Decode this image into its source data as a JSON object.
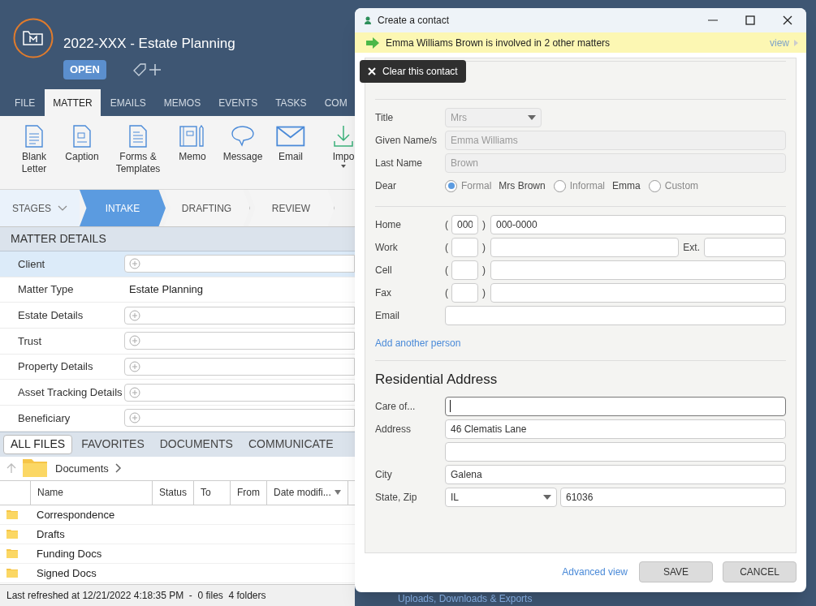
{
  "matter": {
    "title": "2022-XXX - Estate Planning",
    "status": "OPEN"
  },
  "ribbon_tabs": [
    {
      "label": "FILE",
      "selected": false
    },
    {
      "label": "MATTER",
      "selected": true
    },
    {
      "label": "EMAILS",
      "selected": false
    },
    {
      "label": "MEMOS",
      "selected": false
    },
    {
      "label": "EVENTS",
      "selected": false
    },
    {
      "label": "TASKS",
      "selected": false
    },
    {
      "label": "COM",
      "selected": false
    }
  ],
  "ribbon_buttons": [
    {
      "label": "Blank Letter",
      "kind": "letter"
    },
    {
      "label": "Caption",
      "kind": "caption"
    },
    {
      "label": "Forms & Templates",
      "kind": "forms"
    },
    {
      "label": "Memo",
      "kind": "memo"
    },
    {
      "label": "Message",
      "kind": "message"
    },
    {
      "label": "Email",
      "kind": "email"
    },
    {
      "label": "Impo",
      "kind": "import"
    }
  ],
  "stages": {
    "label": "STAGES",
    "items": [
      {
        "label": "INTAKE",
        "selected": true
      },
      {
        "label": "DRAFTING",
        "selected": false
      },
      {
        "label": "REVIEW",
        "selected": false
      }
    ]
  },
  "matter_details": {
    "title": "MATTER DETAILS",
    "rows": [
      {
        "label": "Client",
        "kind": "add",
        "selected": true
      },
      {
        "label": "Matter Type",
        "kind": "text",
        "value": "Estate Planning",
        "selected": false
      },
      {
        "label": "Estate Details",
        "kind": "add",
        "selected": false
      },
      {
        "label": "Trust",
        "kind": "add",
        "selected": false
      },
      {
        "label": "Property Details",
        "kind": "add",
        "selected": false
      },
      {
        "label": "Asset Tracking Details",
        "kind": "add",
        "selected": false
      },
      {
        "label": "Beneficiary",
        "kind": "add",
        "selected": false
      }
    ]
  },
  "file_tabs": [
    {
      "label": "ALL FILES",
      "selected": true
    },
    {
      "label": "FAVORITES",
      "selected": false
    },
    {
      "label": "DOCUMENTS",
      "selected": false
    },
    {
      "label": "COMMUNICATE",
      "selected": false
    }
  ],
  "breadcrumb": "Documents",
  "file_columns": [
    {
      "label": "Name",
      "sorted": false
    },
    {
      "label": "Status",
      "sorted": false
    },
    {
      "label": "To",
      "sorted": false
    },
    {
      "label": "From",
      "sorted": false
    },
    {
      "label": "Date modifi...",
      "sorted": true
    }
  ],
  "files": [
    "Correspondence",
    "Drafts",
    "Funding Docs",
    "Signed Docs"
  ],
  "status_bar": {
    "text": "Last refreshed at 12/21/2022 4:18:35 PM  -  0 files  4 folders",
    "uploads": "Uploads, Downloads & Exports"
  },
  "dialog": {
    "title": "Create a contact",
    "banner": {
      "text": "Emma Williams Brown is involved in 2 other matters",
      "link": "view"
    },
    "clear_button": "Clear this contact",
    "title_field": {
      "label": "Title",
      "value": "Mrs",
      "disabled": true
    },
    "given_names": {
      "label": "Given Name/s",
      "value": "Emma Williams",
      "disabled": true
    },
    "last_name": {
      "label": "Last Name",
      "value": "Brown",
      "disabled": true
    },
    "dear": {
      "label": "Dear",
      "options": [
        {
          "label": "Formal",
          "value": "Mrs Brown",
          "selected": true
        },
        {
          "label": "Informal",
          "value": "Emma",
          "selected": false
        },
        {
          "label": "Custom",
          "selected": false
        }
      ]
    },
    "phones": [
      {
        "label": "Home",
        "open": "(",
        "close": ")",
        "area_placeholder": "000",
        "number_placeholder": "000-0000"
      },
      {
        "label": "Work",
        "open": "(",
        "close": ")",
        "ext_label": "Ext."
      },
      {
        "label": "Cell",
        "open": "(",
        "close": ")"
      },
      {
        "label": "Fax",
        "open": "(",
        "close": ")"
      }
    ],
    "email": {
      "label": "Email"
    },
    "add_person": "Add another person",
    "address": {
      "heading": "Residential Address",
      "care_of": {
        "label": "Care of...",
        "focused": true
      },
      "address_label": "Address",
      "lines": [
        {
          "kind": "filled",
          "value": "46 Clematis Lane"
        },
        {
          "kind": "empty"
        }
      ],
      "city": {
        "label": "City",
        "value": "Galena"
      },
      "state_zip": {
        "label": "State, Zip",
        "state": "IL",
        "zip": "61036"
      }
    },
    "advanced_link": "Advanced view",
    "buttons": [
      "SAVE",
      "CANCEL"
    ]
  }
}
